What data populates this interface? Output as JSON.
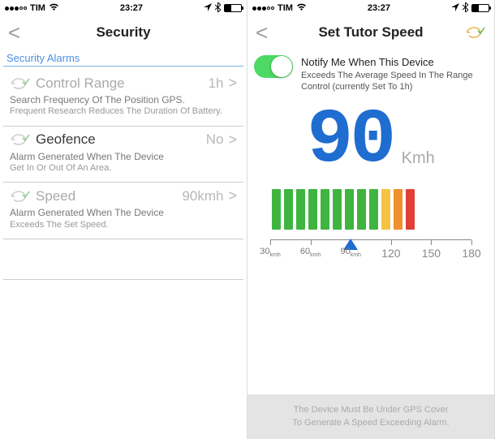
{
  "status": {
    "carrier": "TIM",
    "time": "23:27"
  },
  "screen1": {
    "title": "Security",
    "section_label": "Security Alarms",
    "rows": [
      {
        "title": "Control Range",
        "value": "1h",
        "sub1": "Search Frequency Of The Position GPS.",
        "sub2": "Frequent Research Reduces The Duration Of Battery."
      },
      {
        "title": "Geofence",
        "value": "No",
        "sub1": "Alarm Generated When The Device",
        "sub2": "Get In Or Out Of An Area."
      },
      {
        "title": "Speed",
        "value": "90kmh",
        "sub1": "Alarm Generated When The Device",
        "sub2": "Exceeds The Set Speed."
      }
    ]
  },
  "screen2": {
    "title": "Set Tutor Speed",
    "notify": {
      "line1": "Notify Me When This Device",
      "line2": "Exceeds The Average Speed In The Range",
      "line3": "Control (currently Set To 1h)"
    },
    "speed_value": "90",
    "speed_unit": "Kmh",
    "scale": {
      "t30": "30",
      "t60": "60",
      "t90": "90",
      "t120": "120",
      "t150": "150",
      "t180": "180",
      "kmh_small": "kmh"
    },
    "footer": {
      "line1": "The Device Must Be Under GPS Cover",
      "line2": "To Generate A Speed Exceeding Alarm."
    }
  }
}
